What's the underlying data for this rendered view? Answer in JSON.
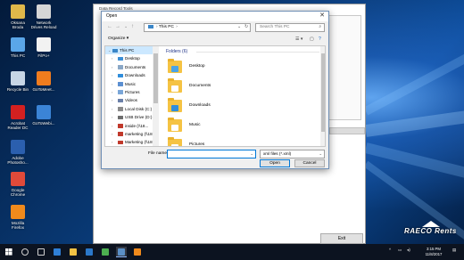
{
  "desktop": {
    "icons": [
      {
        "label": "Oksana\nBroda",
        "icon": "folder-user-icon",
        "color": "#e0b84a"
      },
      {
        "label": "Network\nDrives Reload",
        "icon": "network-drive-icon",
        "color": "#d6d6d6"
      },
      {
        "label": "This PC",
        "icon": "this-pc-icon",
        "color": "#5aa6e8"
      },
      {
        "label": "FilPo+",
        "icon": "app-icon",
        "color": "#f2f2f2"
      },
      {
        "label": "Recycle Bin",
        "icon": "recycle-bin-icon",
        "color": "#c7d6e6"
      },
      {
        "label": "GoToMeet...",
        "icon": "gotomeeting-icon",
        "color": "#f07c1e"
      },
      {
        "label": "Acrobat\nReader DC",
        "icon": "acrobat-icon",
        "color": "#d32020"
      },
      {
        "label": "GoToWebi...",
        "icon": "gotowebinar-icon",
        "color": "#3b84d6"
      },
      {
        "label": "Adobe\nPhotosho...",
        "icon": "photoshop-icon",
        "color": "#2b5fae"
      },
      {
        "label": "Google\nChrome",
        "icon": "chrome-icon",
        "color": "#e04a3a"
      },
      {
        "label": "Mozilla\nFirefox",
        "icon": "firefox-icon",
        "color": "#f08a1c"
      }
    ]
  },
  "bg_window": {
    "title": "Data Record Tools",
    "exit_label": "Exit"
  },
  "dialog": {
    "title": "Open",
    "close_glyph": "✕",
    "address": {
      "location": "This PC",
      "separator": "›",
      "dropdown": "⌄",
      "refresh": "↻"
    },
    "search_placeholder": "Search This PC",
    "search_glyph": "⌕",
    "organize_label": "Organize ▾",
    "view_glyph": "☰ ▾",
    "pane_glyph": "▢",
    "help_glyph": "?",
    "nav": {
      "back": "←",
      "forward": "→",
      "recent": "⌄",
      "up": "↑",
      "items": [
        {
          "label": "This PC",
          "color": "#3a86c8",
          "selected": true,
          "child": false
        },
        {
          "label": "Desktop",
          "color": "#3c8fd6",
          "selected": false,
          "child": true
        },
        {
          "label": "Documents",
          "color": "#8aa7c6",
          "selected": false,
          "child": true
        },
        {
          "label": "Downloads",
          "color": "#2f8ddb",
          "selected": false,
          "child": true
        },
        {
          "label": "Music",
          "color": "#5b8fd1",
          "selected": false,
          "child": true
        },
        {
          "label": "Pictures",
          "color": "#7aa6d8",
          "selected": false,
          "child": true
        },
        {
          "label": "Videos",
          "color": "#6a7fa8",
          "selected": false,
          "child": true
        },
        {
          "label": "Local Disk (C:)",
          "color": "#8a8a8a",
          "selected": false,
          "child": true
        },
        {
          "label": "USB Drive (D:)",
          "color": "#6d6d6d",
          "selected": false,
          "child": true
        },
        {
          "label": "inside (\\\\18...",
          "color": "#c0392b",
          "selected": false,
          "child": true
        },
        {
          "label": "marketing (\\\\18...",
          "color": "#c0392b",
          "selected": false,
          "child": true
        },
        {
          "label": "Marketing (\\\\18...",
          "color": "#c0392b",
          "selected": false,
          "child": true
        }
      ]
    },
    "group_header": "Folders (6)",
    "folders": [
      {
        "name": "Desktop",
        "badge": "#4aa3e6"
      },
      {
        "name": "Documents",
        "badge": "#ffffff"
      },
      {
        "name": "Downloads",
        "badge": "#2f8ddb"
      },
      {
        "name": "Music",
        "badge": "#ffffff"
      },
      {
        "name": "Pictures",
        "badge": "#ffffff"
      }
    ],
    "filename_label": "File name:",
    "filename_value": "",
    "filter_value": "xml files (*.xml)",
    "open_label": "Open",
    "cancel_label": "Cancel"
  },
  "taskbar": {
    "apps": [
      {
        "icon": "windows-start-icon",
        "color": "#ffffff"
      },
      {
        "icon": "search-icon",
        "color": "#d0d0d0"
      },
      {
        "icon": "task-view-icon",
        "color": "#d0d0d0"
      },
      {
        "icon": "edge-icon",
        "color": "#2f7fd6"
      },
      {
        "icon": "file-explorer-icon",
        "color": "#f2c244"
      },
      {
        "icon": "store-icon",
        "color": "#2b78c9"
      },
      {
        "icon": "chrome-icon",
        "color": "#4caf50"
      },
      {
        "icon": "data-tools-icon",
        "color": "#5a8fc7"
      },
      {
        "icon": "app-orange-icon",
        "color": "#f08a1c"
      }
    ],
    "tray_chevron": "^",
    "time": "3:15 PM",
    "date": "11/8/2017"
  },
  "watermark": {
    "text": "RAECO Rents"
  }
}
